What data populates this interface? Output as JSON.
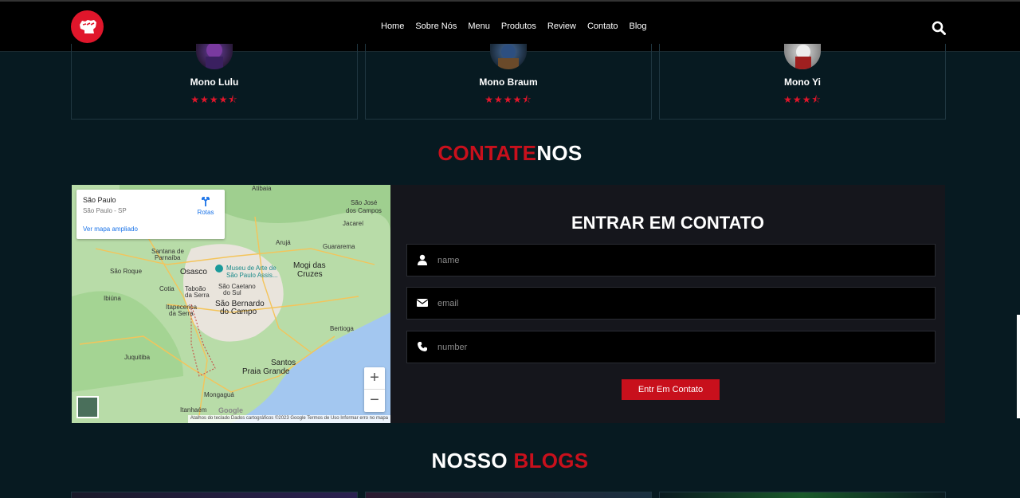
{
  "header": {
    "nav": [
      "Home",
      "Sobre Nós",
      "Menu",
      "Produtos",
      "Review",
      "Contato",
      "Blog"
    ],
    "logo_icon": "fist-logo-icon",
    "search_icon": "search-icon"
  },
  "reviews": [
    {
      "name": "Mono Lulu",
      "stars": "★★★★⯪",
      "rating": 4.5
    },
    {
      "name": "Mono Braum",
      "stars": "★★★★⯪",
      "rating": 4.5
    },
    {
      "name": "Mono Yi",
      "stars": "★★★⯪",
      "rating": 3.5
    }
  ],
  "contact_section": {
    "title_red": "CONTATE",
    "title_white": "NOS"
  },
  "map": {
    "place": "São Paulo",
    "place_sub": "São Paulo - SP",
    "routes": "Rotas",
    "enlarged_link": "Ver mapa ampliado",
    "labels": {
      "sao_jose": "São José",
      "dos_campos": "dos Campos",
      "jacarei": "Jacareí",
      "guararema": "Guararema",
      "aruja": "Arujá",
      "mogi": "Mogi das",
      "cruzes": "Cruzes",
      "osasco": "Osasco",
      "santana": "Santana de",
      "parnaiba": "Parnaíba",
      "sao_roque": "São Roque",
      "cotia": "Cotia",
      "taboao": "Taboão",
      "da_serra": "da Serra",
      "ibiuna": "Ibiúna",
      "itapecerica": "Itapecerica",
      "da_serra2": "da Serra",
      "sao_caetano": "São Caetano",
      "do_sul": "do Sul",
      "sao_bernardo": "São Bernardo",
      "do_campo": "do Campo",
      "museu": "Museu de Arte de",
      "museu2": "São Paulo Assis...",
      "bertioga": "Bertioga",
      "juquitiba": "Juquitiba",
      "santos": "Santos",
      "praia_grande": "Praia Grande",
      "mongagua": "Mongaguá",
      "itanhaem": "Itanhaém",
      "atibaia": "Atibaia"
    },
    "attribution": "Atalhos do teclado   Dados cartográficos ©2023 Google   Termos de Uso   Informar erro no mapa",
    "google": "Google",
    "zoom_in": "+",
    "zoom_out": "−"
  },
  "form": {
    "title": "ENTRAR EM CONTATO",
    "name_placeholder": "name",
    "email_placeholder": "email",
    "number_placeholder": "number",
    "submit_label": "Entr Em Contato"
  },
  "blogs_section": {
    "title_white": "NOSSO",
    "title_red": "BLOGS"
  },
  "colors": {
    "accent": "#c8101c",
    "background": "#071a21",
    "panel": "#15161c"
  }
}
